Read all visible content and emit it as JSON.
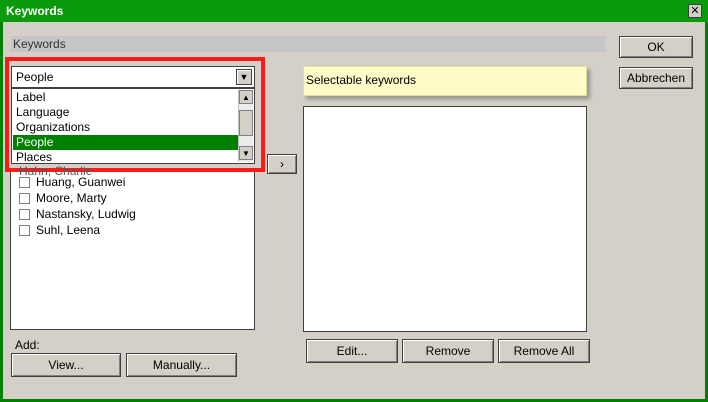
{
  "window": {
    "title": "Keywords",
    "close_label": "✕"
  },
  "section_title": "Keywords",
  "buttons": {
    "ok": "OK",
    "cancel": "Abbrechen",
    "add_arrow": "›",
    "edit": "Edit...",
    "remove": "Remove",
    "remove_all": "Remove All",
    "view": "View...",
    "manually": "Manually..."
  },
  "combo": {
    "value": "People",
    "arrow": "▼"
  },
  "dropdown": {
    "items": [
      "Label",
      "Language",
      "Organizations",
      "People",
      "Places"
    ],
    "selected": "People",
    "up": "▲",
    "down": "▼"
  },
  "left_list": {
    "partial_item": "Hahn, Charlie",
    "items": [
      "Huang, Guanwei",
      "Moore, Marty",
      "Nastansky, Ludwig",
      "Suhl, Leena"
    ]
  },
  "selectable_label": "Selectable keywords",
  "add_label": "Add:",
  "colors": {
    "title_bar": "#0b9a0b",
    "selected_item": "#008000",
    "highlight": "#ff1a1a",
    "note_bg": "#fffbc8"
  }
}
